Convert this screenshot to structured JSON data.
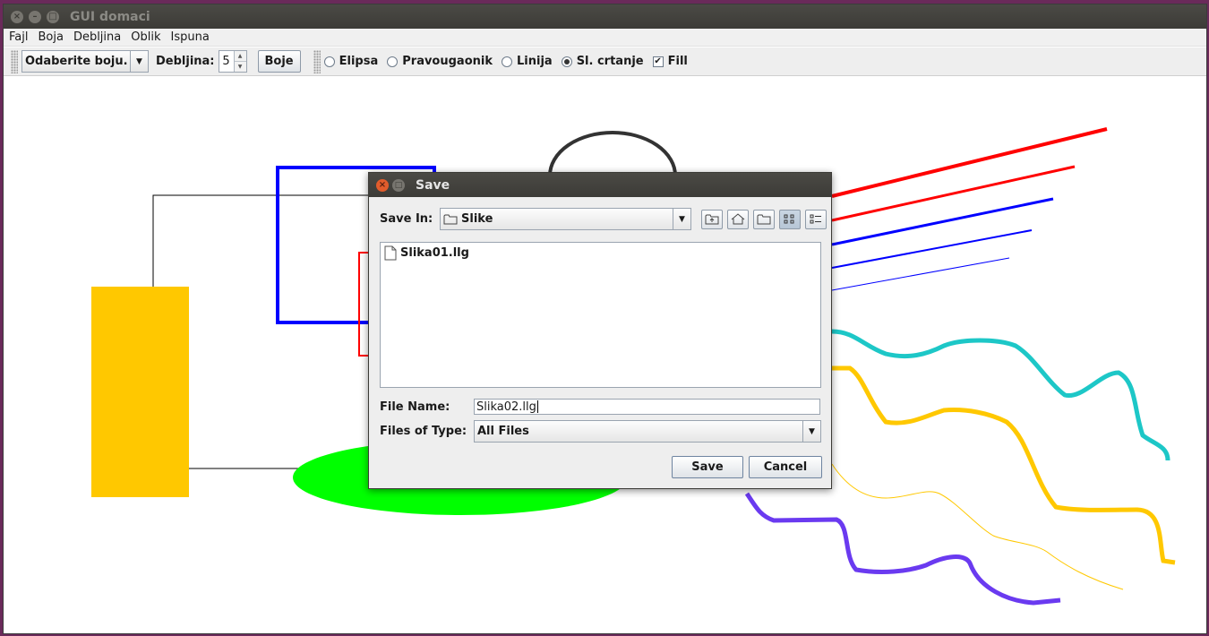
{
  "window": {
    "title": "GUI domaci"
  },
  "menubar": {
    "items": [
      "Fajl",
      "Boja",
      "Debljina",
      "Oblik",
      "Ispuna"
    ]
  },
  "toolbar": {
    "color_combo": "Odaberite boju.",
    "thickness_label": "Debljina:",
    "thickness_value": "5",
    "colors_button": "Boje",
    "shapes": [
      {
        "label": "Elipsa",
        "checked": false
      },
      {
        "label": "Pravougaonik",
        "checked": false
      },
      {
        "label": "Linija",
        "checked": false
      },
      {
        "label": "Sl. crtanje",
        "checked": true
      }
    ],
    "fill_label": "Fill",
    "fill_checked": true
  },
  "dialog": {
    "title": "Save",
    "save_in_label": "Save In:",
    "save_in_value": "Slike",
    "files": [
      "Slika01.llg"
    ],
    "file_name_label": "File Name:",
    "file_name_value": "Slika02.llg",
    "files_of_type_label": "Files of Type:",
    "files_of_type_value": "All Files",
    "save_button": "Save",
    "cancel_button": "Cancel"
  },
  "colors": {
    "yellow": "#ffc800",
    "blue": "#0000ff",
    "red": "#ff0000",
    "green": "#00ff00",
    "cyan": "#1dc7c7",
    "purple": "#6a3af0",
    "dark": "#333333"
  }
}
